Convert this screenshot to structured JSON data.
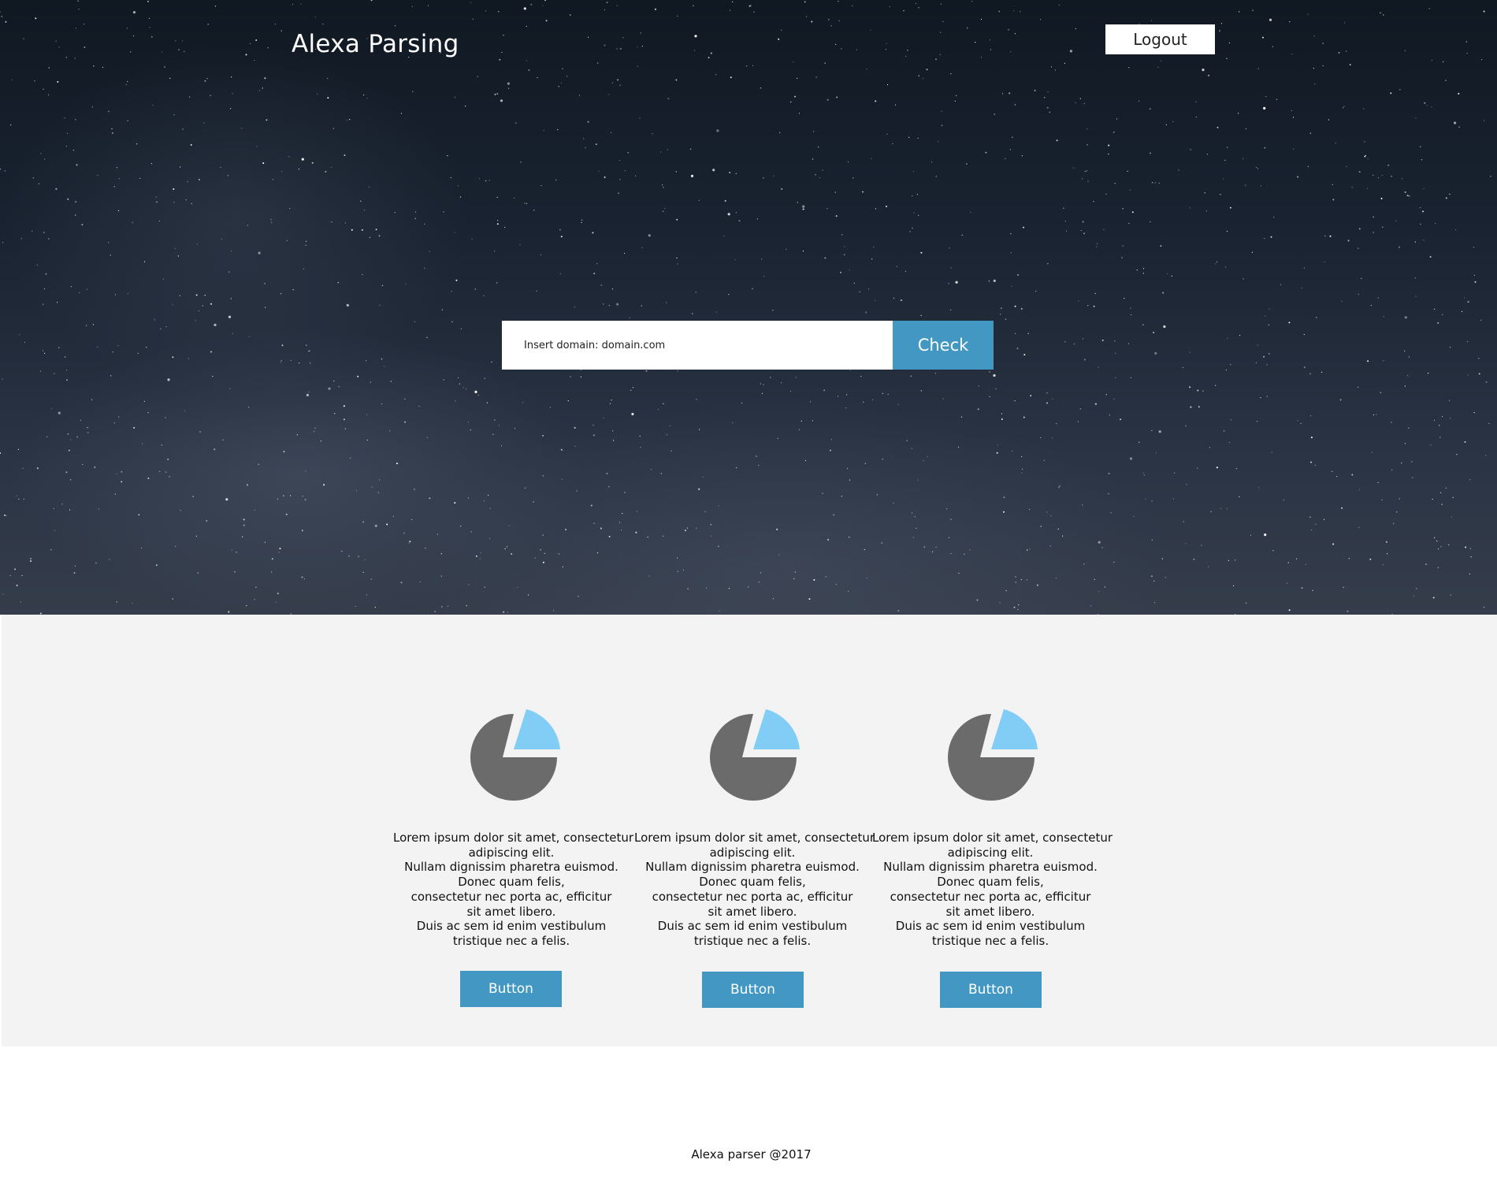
{
  "header": {
    "brand": "Alexa Parsing",
    "logout_label": "Logout"
  },
  "search": {
    "placeholder": "Insert domain: domain.com",
    "check_label": "Check"
  },
  "features": [
    {
      "icon": "pie-chart-icon",
      "lines": [
        "Lorem ipsum dolor sit amet, consectetur",
        "adipiscing elit.",
        "Nullam dignissim pharetra euismod.",
        "Donec quam felis,",
        "consectetur nec porta ac, efficitur",
        "sit amet libero.",
        "Duis ac sem id enim vestibulum",
        "tristique nec a felis."
      ],
      "button_label": "Button"
    },
    {
      "icon": "pie-chart-icon",
      "lines": [
        "Lorem ipsum dolor sit amet, consectetur",
        "adipiscing elit.",
        "Nullam dignissim pharetra euismod.",
        "Donec quam felis,",
        "consectetur nec porta ac, efficitur",
        "sit amet libero.",
        "Duis ac sem id enim vestibulum",
        "tristique nec a felis."
      ],
      "button_label": "Button"
    },
    {
      "icon": "pie-chart-icon",
      "lines": [
        "Lorem ipsum dolor sit amet, consectetur",
        "adipiscing elit.",
        "Nullam dignissim pharetra euismod.",
        "Donec quam felis,",
        "consectetur nec porta ac, efficitur",
        "sit amet libero.",
        "Duis ac sem id enim vestibulum",
        "tristique nec a felis."
      ],
      "button_label": "Button"
    }
  ],
  "footer": {
    "text": "Alexa parser @2017"
  },
  "colors": {
    "accent": "#4298c3",
    "pie_main": "#6b6b6b",
    "pie_slice": "#81cdf6",
    "section_bg": "#f3f3f3"
  }
}
